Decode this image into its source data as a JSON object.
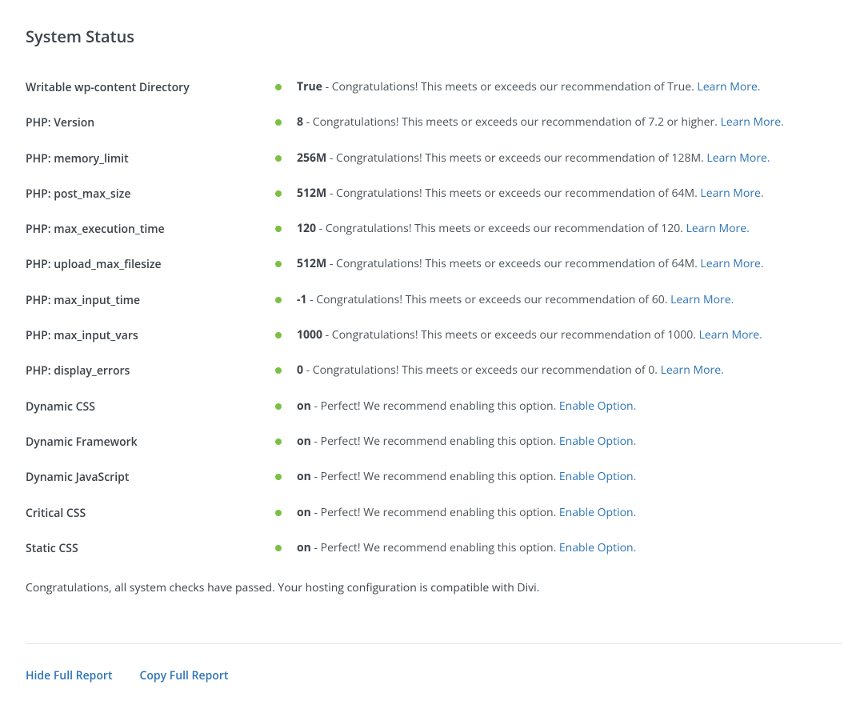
{
  "title": "System Status",
  "status_dot_color": "#7bc042",
  "link_color": "#2e74b5",
  "items": [
    {
      "label": "Writable wp-content Directory",
      "value": "True",
      "message": " - Congratulations! This meets or exceeds our recommendation of True. ",
      "link": "Learn More."
    },
    {
      "label": "PHP: Version",
      "value": "8",
      "message": " - Congratulations! This meets or exceeds our recommendation of 7.2 or higher. ",
      "link": "Learn More."
    },
    {
      "label": "PHP: memory_limit",
      "value": "256M",
      "message": " - Congratulations! This meets or exceeds our recommendation of 128M. ",
      "link": "Learn More."
    },
    {
      "label": "PHP: post_max_size",
      "value": "512M",
      "message": " - Congratulations! This meets or exceeds our recommendation of 64M. ",
      "link": "Learn More."
    },
    {
      "label": "PHP: max_execution_time",
      "value": "120",
      "message": " - Congratulations! This meets or exceeds our recommendation of 120. ",
      "link": "Learn More."
    },
    {
      "label": "PHP: upload_max_filesize",
      "value": "512M",
      "message": " - Congratulations! This meets or exceeds our recommendation of 64M. ",
      "link": "Learn More."
    },
    {
      "label": "PHP: max_input_time",
      "value": "-1",
      "message": " - Congratulations! This meets or exceeds our recommendation of 60. ",
      "link": "Learn More."
    },
    {
      "label": "PHP: max_input_vars",
      "value": "1000",
      "message": " - Congratulations! This meets or exceeds our recommendation of 1000. ",
      "link": "Learn More."
    },
    {
      "label": "PHP: display_errors",
      "value": "0",
      "message": " - Congratulations! This meets or exceeds our recommendation of 0. ",
      "link": "Learn More."
    },
    {
      "label": "Dynamic CSS",
      "value": "on",
      "message": " - Perfect! We recommend enabling this option. ",
      "link": "Enable Option."
    },
    {
      "label": "Dynamic Framework",
      "value": "on",
      "message": " - Perfect! We recommend enabling this option. ",
      "link": "Enable Option."
    },
    {
      "label": "Dynamic JavaScript",
      "value": "on",
      "message": " - Perfect! We recommend enabling this option. ",
      "link": "Enable Option."
    },
    {
      "label": "Critical CSS",
      "value": "on",
      "message": " - Perfect! We recommend enabling this option. ",
      "link": "Enable Option."
    },
    {
      "label": "Static CSS",
      "value": "on",
      "message": " - Perfect! We recommend enabling this option. ",
      "link": "Enable Option."
    }
  ],
  "summary": "Congratulations, all system checks have passed. Your hosting configuration is compatible with Divi.",
  "actions": {
    "hide_full_report": "Hide Full Report",
    "copy_full_report": "Copy Full Report"
  }
}
